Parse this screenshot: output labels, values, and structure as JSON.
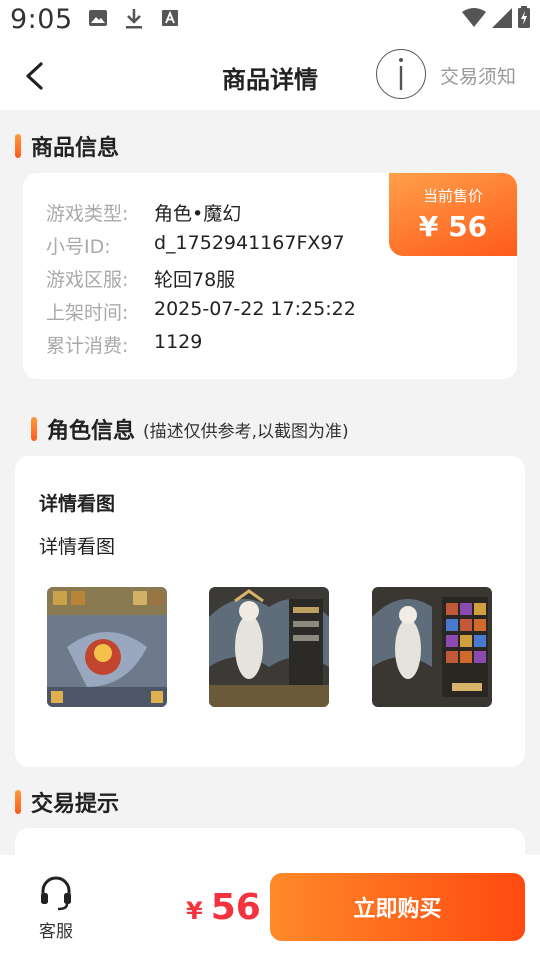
{
  "status": {
    "time": "9:05"
  },
  "header": {
    "title": "商品详情",
    "notice_link": "交易须知"
  },
  "product_section": {
    "title": "商品信息"
  },
  "product_info": {
    "rows": [
      {
        "label": "游戏类型:",
        "value": "角色•魔幻"
      },
      {
        "label": "小号ID:",
        "value": "d_1752941167FX97"
      },
      {
        "label": "游戏区服:",
        "value": "轮回78服"
      },
      {
        "label": "上架时间:",
        "value": "2025-07-22 17:25:22"
      },
      {
        "label": "累计消费:",
        "value": "1129"
      }
    ],
    "price_label": "当前售价",
    "price": "¥ 56"
  },
  "role_section": {
    "title": "角色信息",
    "note": "(描述仅供参考,以截图为准)"
  },
  "detail": {
    "heading": "详情看图",
    "subtitle": "详情看图",
    "thumbnails": [
      "screenshot-1",
      "screenshot-2",
      "screenshot-3"
    ]
  },
  "tips_section": {
    "title": "交易提示"
  },
  "bottom": {
    "service_label": "客服",
    "currency": "¥",
    "price": "56",
    "buy_label": "立即购买"
  },
  "colors": {
    "accent": "#ff5a1f",
    "price_red": "#f5333f"
  }
}
